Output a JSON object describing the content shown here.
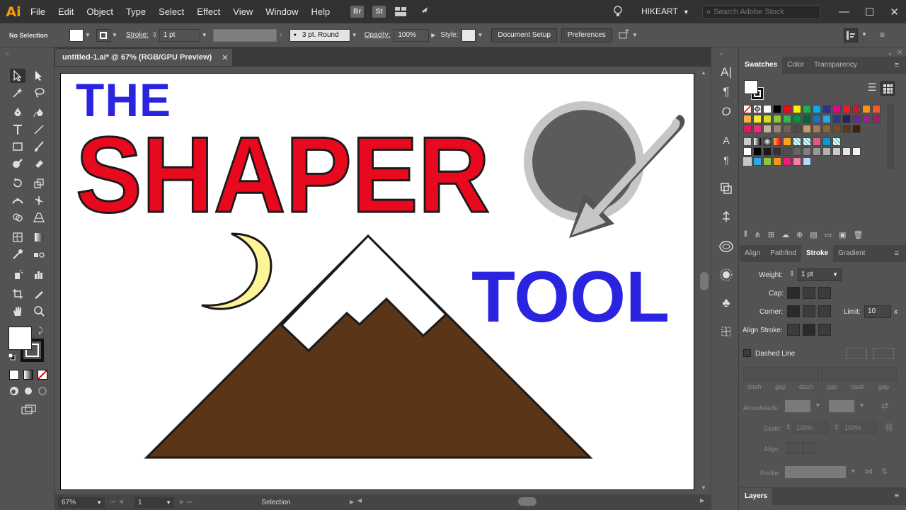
{
  "app": {
    "logo": "Ai"
  },
  "menu": [
    "File",
    "Edit",
    "Object",
    "Type",
    "Select",
    "Effect",
    "View",
    "Window",
    "Help"
  ],
  "menubar_badges": {
    "bridge": "Br",
    "stock": "St"
  },
  "workspace": "HIKEART",
  "search": {
    "placeholder": "Search Adobe Stock"
  },
  "window_controls": {
    "minimize": "—",
    "maximize": "☐",
    "close": "✕"
  },
  "control_bar": {
    "selection_label": "No Selection",
    "stroke_label": "Stroke:",
    "stroke_weight": "1 pt",
    "brush": "3 pt. Round",
    "opacity_label": "Opacity:",
    "opacity_value": "100%",
    "style_label": "Style:",
    "document_setup": "Document Setup",
    "preferences": "Preferences"
  },
  "document": {
    "tab_title": "untitled-1.ai* @ 67% (RGB/GPU Preview)",
    "close": "✕"
  },
  "artwork": {
    "word1": "THE",
    "word2": "SHAPER",
    "word3": "TOOL"
  },
  "status_bar": {
    "zoom": "67%",
    "page": "1",
    "tool": "Selection"
  },
  "swatches_panel": {
    "tabs": [
      "Swatches",
      "Color",
      "Transparency"
    ]
  },
  "stroke_panel": {
    "tabs": [
      "Align",
      "Pathfind",
      "Stroke",
      "Gradient"
    ],
    "weight_label": "Weight:",
    "weight_value": "1 pt",
    "cap_label": "Cap:",
    "corner_label": "Corner:",
    "limit_label": "Limit:",
    "limit_value": "10",
    "limit_unit": "x",
    "align_label": "Align Stroke:",
    "dashed_label": "Dashed Line",
    "dash_labels": [
      "dash",
      "gap",
      "dash",
      "gap",
      "dash",
      "gap"
    ],
    "arrowheads_label": "Arrowheads:",
    "scale_label": "Scale:",
    "scale_value1": "100%",
    "scale_value2": "100%",
    "align_arrow_label": "Align:",
    "profile_label": "Profile:"
  },
  "layers_panel": {
    "tab": "Layers"
  },
  "colors": {
    "shaper_red": "#e8091f",
    "blue": "#2a24e0",
    "mountain_brown": "#5a3518",
    "moon_yellow": "#fdf49a",
    "circle_gray": "#5b5b5b",
    "pencil_gray": "#c6c6c6"
  }
}
